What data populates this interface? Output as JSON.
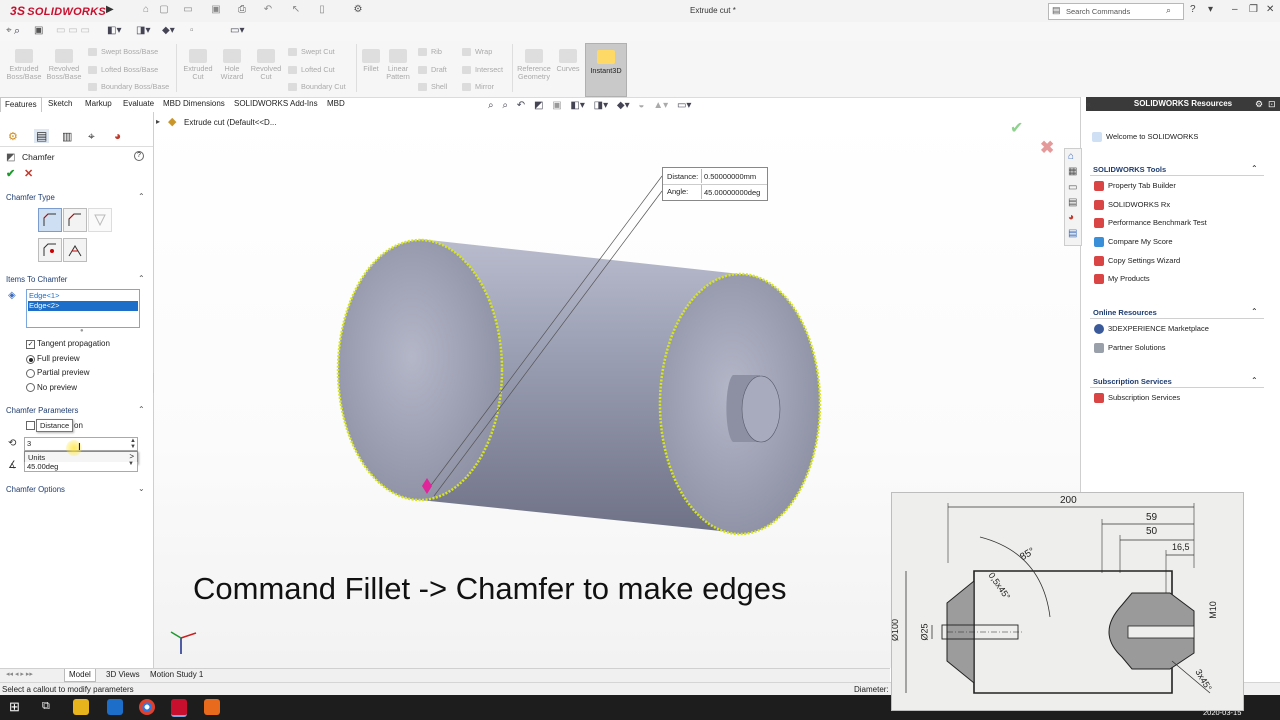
{
  "app": {
    "brand": "SOLIDWORKS",
    "doc_title": "Extrude cut *",
    "search_placeholder": "Search Commands"
  },
  "ribbon": {
    "extruded_boss": "Extruded Boss/Base",
    "revolved_boss": "Revolved Boss/Base",
    "swept_boss": "Swept Boss/Base",
    "lofted_boss": "Lofted Boss/Base",
    "boundary_boss": "Boundary Boss/Base",
    "extruded_cut": "Extruded Cut",
    "hole_wizard": "Hole Wizard",
    "revolved_cut": "Revolved Cut",
    "swept_cut": "Swept Cut",
    "lofted_cut": "Lofted Cut",
    "boundary_cut": "Boundary Cut",
    "fillet": "Fillet",
    "linear_pattern": "Linear Pattern",
    "rib": "Rib",
    "draft": "Draft",
    "shell": "Shell",
    "wrap": "Wrap",
    "intersect": "Intersect",
    "mirror": "Mirror",
    "reference_geometry": "Reference Geometry",
    "curves": "Curves",
    "instant3d": "Instant3D"
  },
  "tabs": [
    "Features",
    "Sketch",
    "Markup",
    "Evaluate",
    "MBD Dimensions",
    "SOLIDWORKS Add-Ins",
    "MBD"
  ],
  "tree": {
    "breadcrumb": "Extrude cut  (Default<<D..."
  },
  "panel": {
    "title": "Chamfer",
    "chamfer_type_label": "Chamfer Type",
    "items_label": "Items To Chamfer",
    "items": [
      "Edge<1>",
      "Edge<2>"
    ],
    "tangent_propagation": "Tangent propagation",
    "preview_options": [
      "Full preview",
      "Partial preview",
      "No preview"
    ],
    "preview_selected": "Full preview",
    "parameters_label": "Chamfer Parameters",
    "distance_tooltip": "Distance",
    "flip_suffix": "on",
    "distance_value": "3",
    "units_label": "Units",
    "angle_value": "45.00deg",
    "options_label": "Chamfer Options"
  },
  "callout": {
    "distance_label": "Distance:",
    "distance_value": "0.50000000mm",
    "angle_label": "Angle:",
    "angle_value": "45.00000000deg"
  },
  "caption": "Command Fillet -> Chamfer to make edges",
  "taskpane": {
    "title": "SOLIDWORKS Resources",
    "welcome": "Welcome to SOLIDWORKS",
    "tools_head": "SOLIDWORKS Tools",
    "tools": [
      "Property Tab Builder",
      "SOLIDWORKS Rx",
      "Performance Benchmark Test",
      "Compare My Score",
      "Copy Settings Wizard",
      "My Products"
    ],
    "online_head": "Online Resources",
    "online": [
      "3DEXPERIENCE Marketplace",
      "Partner Solutions"
    ],
    "subs_head": "Subscription Services",
    "subs": [
      "Subscription Services"
    ]
  },
  "bottom_tabs": [
    "Model",
    "3D Views",
    "Motion Study 1"
  ],
  "status": {
    "message": "Select a callout to modify parameters",
    "diameter_label": "Diameter:"
  },
  "drawing": {
    "dims": {
      "d200": "200",
      "d59": "59",
      "d50": "50",
      "d16_5": "16,5",
      "a85": "85°",
      "c05": "0,5x45°",
      "d100": "Ø100",
      "d25": "Ø25",
      "m10": "M10",
      "c3": "3x45°"
    }
  },
  "taskbar": {
    "date": "2020-03-15"
  },
  "colors": {
    "accent": "#c8102e",
    "selection": "#1c6ec8",
    "edge_highlight": "#d7e61c"
  }
}
